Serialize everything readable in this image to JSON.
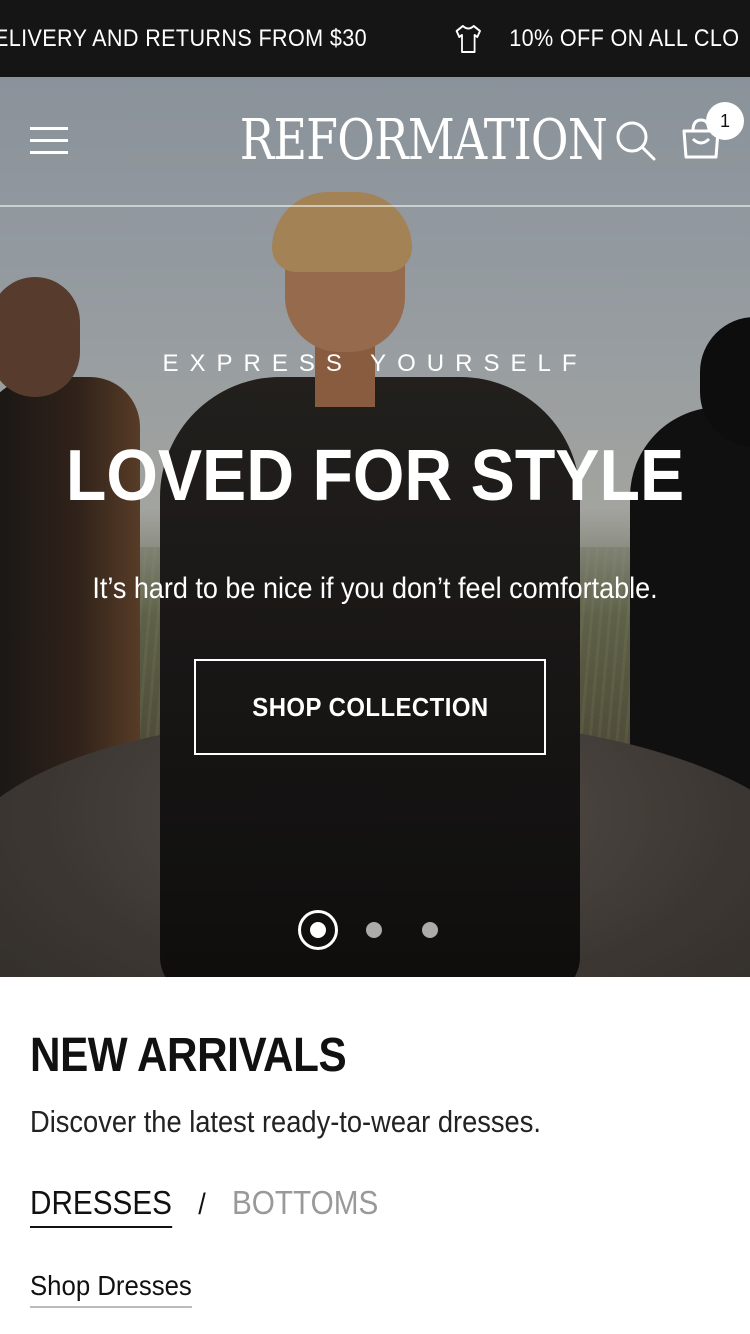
{
  "announcement": {
    "messages": [
      "ELIVERY AND RETURNS FROM $30",
      "10% OFF ON ALL CLO"
    ],
    "icon": "tshirt-icon"
  },
  "header": {
    "logo": "REFORMATION",
    "cart_count": "1",
    "icons": [
      "menu-icon",
      "search-icon",
      "shopping-bag-icon"
    ]
  },
  "hero": {
    "eyebrow": "EXPRESS YOURSELF",
    "title": "LOVED FOR STYLE",
    "subtitle": "It’s hard to be nice if you don’t feel comfortable.",
    "cta": "SHOP COLLECTION",
    "slides_total": 3,
    "active_slide": 1
  },
  "new_arrivals": {
    "title": "NEW ARRIVALS",
    "description": "Discover the latest ready-to-wear dresses.",
    "tabs": [
      {
        "label": "DRESSES",
        "active": true
      },
      {
        "label": "BOTTOMS",
        "active": false
      }
    ],
    "separator": "/",
    "shop_link": "Shop Dresses"
  },
  "colors": {
    "announcement_bg": "#151515",
    "text": "#111111",
    "inactive_tab": "#999999"
  }
}
